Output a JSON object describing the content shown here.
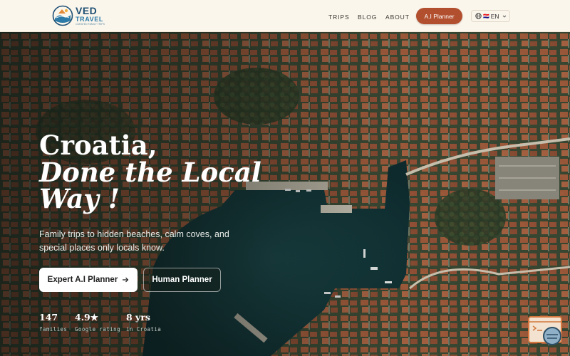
{
  "logo": {
    "name": "VED",
    "sub": "TRAVEL",
    "tagline": "CURATED FAMILY TRIPS"
  },
  "nav": {
    "links": [
      "TRIPS",
      "BLOG",
      "ABOUT"
    ],
    "planner_label": "A.I Planner",
    "language": {
      "flag": "🇭🇷",
      "code": "EN"
    }
  },
  "hero": {
    "title_line1": "Croatia,",
    "title_line2": "Done the Local",
    "title_line3": "Way !",
    "subtitle": "Family trips to hidden beaches, calm coves, and special places only locals know.",
    "primary_cta": "Expert A.I Planner",
    "secondary_cta": "Human Planner",
    "stats": [
      {
        "value": "147",
        "label": "families"
      },
      {
        "value": "4.9★",
        "label": "Google rating"
      },
      {
        "value": "8 yrs",
        "label": "in Croatia"
      }
    ]
  },
  "colors": {
    "accent": "#b24f2e",
    "header_bg": "#fbf6ec",
    "sea": "#13393c",
    "roof": "#b5603f"
  }
}
